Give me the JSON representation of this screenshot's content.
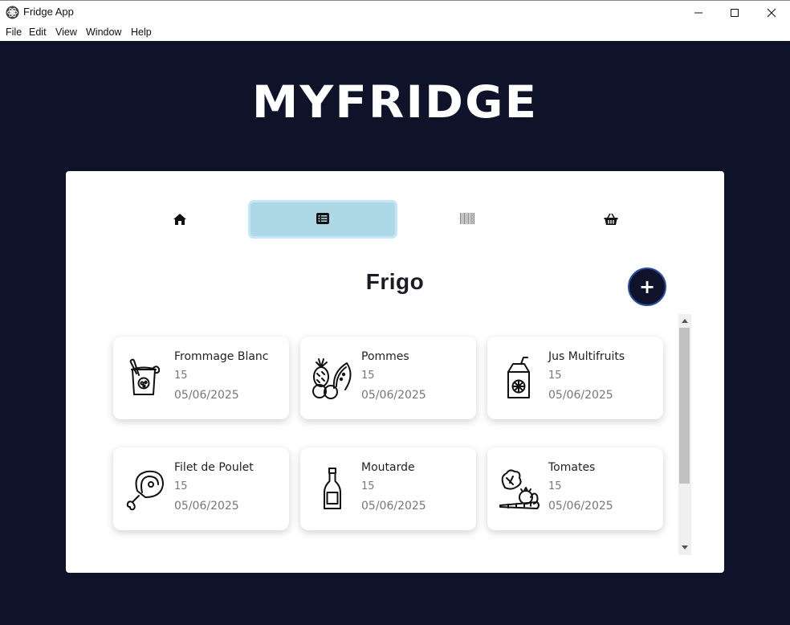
{
  "window": {
    "title": "Fridge App",
    "controls": [
      "minimize-icon",
      "maximize-icon",
      "close-icon"
    ]
  },
  "menu": [
    "File",
    "Edit",
    "View",
    "Window",
    "Help"
  ],
  "app": {
    "logo": "MYFRIDGE",
    "nav": [
      {
        "icon": "home-icon",
        "active": false
      },
      {
        "icon": "list-icon",
        "active": true
      },
      {
        "icon": "barcode-icon",
        "active": false
      },
      {
        "icon": "basket-icon",
        "active": false
      }
    ],
    "section_title": "Frigo",
    "add_label": "+",
    "items": [
      {
        "name": "Frommage Blanc",
        "qty": "15",
        "date": "05/06/2025",
        "icon": "yogurt-icon"
      },
      {
        "name": "Pommes",
        "qty": "15",
        "date": "05/06/2025",
        "icon": "fruits-icon"
      },
      {
        "name": "Jus Multifruits",
        "qty": "15",
        "date": "05/06/2025",
        "icon": "juice-box-icon"
      },
      {
        "name": "Filet de Poulet",
        "qty": "15",
        "date": "05/06/2025",
        "icon": "meat-icon"
      },
      {
        "name": "Moutarde",
        "qty": "15",
        "date": "05/06/2025",
        "icon": "bottle-icon"
      },
      {
        "name": "Tomates",
        "qty": "15",
        "date": "05/06/2025",
        "icon": "vegetables-icon"
      }
    ]
  },
  "colors": {
    "background": "#0f1329",
    "active_tab": "#add8e6",
    "panel": "#ffffff"
  }
}
